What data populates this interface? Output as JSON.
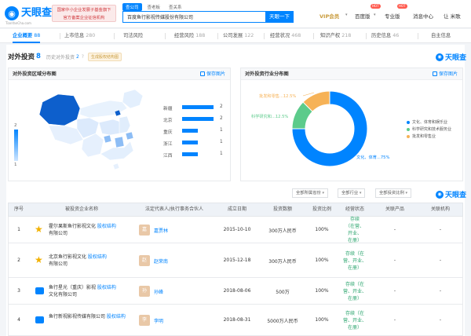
{
  "colors": {
    "accent": "#0084ff",
    "vip": "#c99b3c",
    "status": "#27a36b",
    "hot": "#ff5a4e"
  },
  "header": {
    "logo_text": "天眼查",
    "logo_url": "TianYanCha.com",
    "promo_line1": "国家中小企业发展子基金旗下",
    "promo_line2": "官方备案企业征信机构",
    "search_tabs": [
      "查公司",
      "查老板",
      "查关系"
    ],
    "search_value": "百度鱼行影视传媒股份有限公司",
    "search_button": "天眼一下",
    "vip_label": "VIP会员",
    "hot_badge": "HOT",
    "nav": [
      "百度版",
      "专业版",
      "消息中心",
      "让 米歌"
    ]
  },
  "tabs": [
    {
      "label": "企业概要",
      "count": "88"
    },
    {
      "label": "上市信息",
      "count": "280"
    },
    {
      "label": "司法风险",
      "count": ""
    },
    {
      "label": "经营风险",
      "count": "188"
    },
    {
      "label": "公司发展",
      "count": "122"
    },
    {
      "label": "经营状况",
      "count": "468"
    },
    {
      "label": "知识产权",
      "count": "218"
    },
    {
      "label": "历史信息",
      "count": "46"
    },
    {
      "label": "自主信息",
      "count": ""
    }
  ],
  "section": {
    "title": "对外投资",
    "count": "8",
    "sub_label": "历史对外投资",
    "sub_count": "2",
    "sub_q": "?",
    "badge": "生成股权结构图",
    "watermark": "天眼查"
  },
  "map_card": {
    "title": "对外投资区域分布图",
    "save": "保存图片",
    "legend_max": "2",
    "legend_min": "1",
    "provinces": [
      {
        "name": "新疆",
        "value": 2
      },
      {
        "name": "北京",
        "value": 2
      },
      {
        "name": "重庆",
        "value": 1
      },
      {
        "name": "浙江",
        "value": 1
      },
      {
        "name": "江西",
        "value": 1
      }
    ]
  },
  "industry_card": {
    "title": "对外投资行业分布图",
    "save": "保存图片"
  },
  "chart_data": {
    "type": "pie",
    "title": "对外投资行业分布图",
    "slices": [
      {
        "name": "文化、体育和娱乐业",
        "percent": 75,
        "color": "#0084ff"
      },
      {
        "name": "科学研究和技术服务业",
        "percent": 12.5,
        "color": "#5ccb8b"
      },
      {
        "name": "批发和零售业",
        "percent": 12.5,
        "color": "#f6b257"
      }
    ],
    "slice_labels": [
      "文化、体育...75%",
      "科学研究和...12.5%",
      "批发和零售...12.5%"
    ],
    "legend_placement": "right"
  },
  "filters": [
    "全部所属省份",
    "全部行业",
    "全部投资比例"
  ],
  "table": {
    "columns": [
      "序号",
      "被投资企业名称",
      "法定代表人/执行事务合伙人",
      "成立日期",
      "投资数额",
      "投资比例",
      "经营状态",
      "关联产品",
      "关联机构"
    ],
    "equity_link": "股权结构",
    "rows": [
      {
        "index": "1",
        "name_a": "霍尔果斯鱼行影视文化",
        "name_b": "有限公司",
        "avatar": "嘉",
        "person": "嘉贾林",
        "date": "2015-10-10",
        "amount": "300万人民币",
        "ratio": "100%",
        "status": [
          "存续",
          "（在营、",
          "开业、",
          "在册）"
        ],
        "product": "-",
        "org": "-",
        "logo": "star"
      },
      {
        "index": "2",
        "name_a": "北京鱼行影视文化",
        "name_b": "有限公司",
        "avatar": "赵",
        "person": "赵荣南",
        "date": "2015-12-18",
        "amount": "300万人民币",
        "ratio": "100%",
        "status": [
          "存续（在",
          "营、开业、",
          "在册）"
        ],
        "product": "-",
        "org": "-",
        "logo": "star"
      },
      {
        "index": "3",
        "name_a": "鱼行星光（重庆）影视",
        "name_b": "文化有限公司",
        "avatar": "孙",
        "person": "孙峰",
        "date": "2018-08-06",
        "amount": "500万",
        "ratio": "100%",
        "status": [
          "存续（在",
          "营、开业、",
          "在册）"
        ],
        "product": "-",
        "org": "-",
        "logo": "blue"
      },
      {
        "index": "4",
        "name_a": "鱼行新视影视传媒有限公司",
        "name_b": "",
        "avatar": "李",
        "person": "李明",
        "date": "2018-08-31",
        "amount": "5000万人民币",
        "ratio": "100%",
        "status": [
          "存续（在",
          "营、开业、",
          "在册）"
        ],
        "product": "-",
        "org": "-",
        "logo": "blue"
      }
    ]
  }
}
